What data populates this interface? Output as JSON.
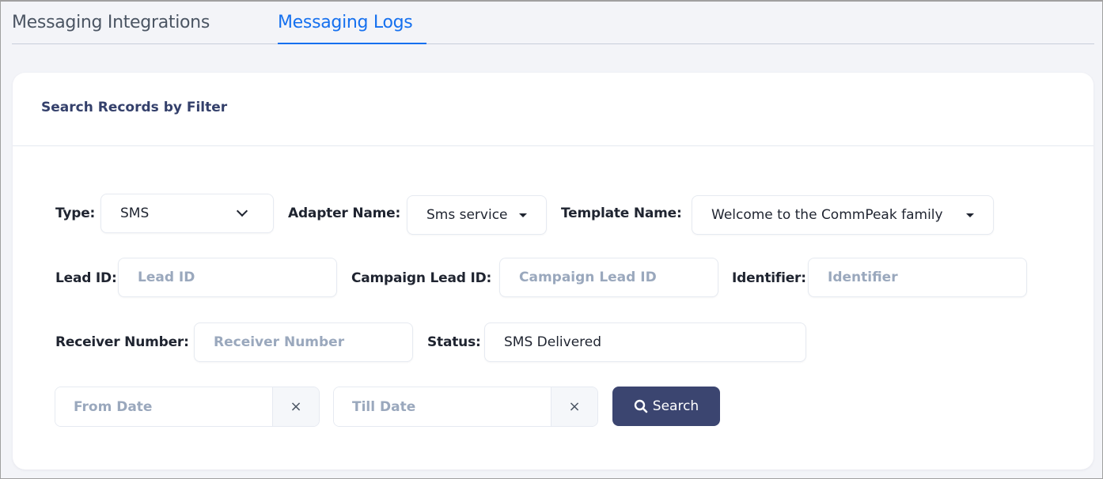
{
  "tabs": [
    {
      "label": "Messaging Integrations",
      "active": false
    },
    {
      "label": "Messaging Logs",
      "active": true
    }
  ],
  "colors": {
    "accent": "#1570ef",
    "primary_button": "#3b4570",
    "title": "#34406b",
    "placeholder": "#9aa8bd"
  },
  "filter_card": {
    "title": "Search Records by Filter",
    "type": {
      "label": "Type:",
      "value": "SMS",
      "icon": "chevron-down-icon"
    },
    "adapter_name": {
      "label": "Adapter Name:",
      "value": "Sms service",
      "icon": "caret-down-icon"
    },
    "template_name": {
      "label": "Template Name:",
      "value": "Welcome to the CommPeak family",
      "icon": "caret-down-icon"
    },
    "lead_id": {
      "label": "Lead ID:",
      "placeholder": "Lead ID",
      "value": ""
    },
    "campaign_lead_id": {
      "label": "Campaign Lead ID:",
      "placeholder": "Campaign Lead ID",
      "value": ""
    },
    "identifier": {
      "label": "Identifier:",
      "placeholder": "Identifier",
      "value": ""
    },
    "receiver_number": {
      "label": "Receiver Number:",
      "placeholder": "Receiver Number",
      "value": ""
    },
    "status": {
      "label": "Status:",
      "value": "SMS Delivered"
    },
    "from_date": {
      "placeholder": "From Date",
      "clear_icon": "×"
    },
    "till_date": {
      "placeholder": "Till Date",
      "clear_icon": "×"
    },
    "search_button": {
      "label": "Search",
      "icon": "search-icon"
    }
  }
}
